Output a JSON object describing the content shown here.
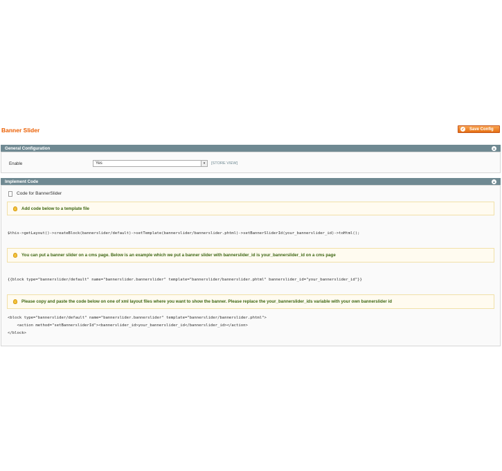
{
  "page": {
    "title": "Banner Slider",
    "save_label": "Save Config"
  },
  "general": {
    "header": "General Configuration",
    "enable_label": "Enable",
    "enable_value": "Yes",
    "scope": "[STORE VIEW]"
  },
  "implement": {
    "header": "Implement Code",
    "title": "Code for BannerSlider",
    "note1": "Add code below to a template file",
    "code1": "$this->getLayout()->createBlock(bannerslider/default)->setTemplate(bannerslider/bannerslider.phtml)->setBannerSliderId(your_bannerslider_id)->toHtml();",
    "note2": "You can put a banner slider on a cms page. Below is an example which we put a banner slider with bannerslider_id is your_bannerslider_id on a cms page",
    "code2": "{{block type=\"bannerslider/default\" name=\"bannerslider.bannerslider\" template=\"bannerslider/bannerslider.phtml\" bannerslider_id=\"your_bannerslider_id\"}}",
    "note3": "Please copy and paste the code below on one of xml layout files where you want to show the banner. Please replace the your_bannerslider_ids variable with your own bannerslider id",
    "code3_line1": "<block type=\"bannerslider/default\" name=\"bannerslider.bannerslider\" template=\"bannerslider/bannerslider.phtml\">",
    "code3_line2": "    <action method=\"setBannersliderId\"><bannerslider_id>your_bannerslider_id</bannerslider_id></action>",
    "code3_line3": "</block>"
  },
  "colors": {
    "accent": "#eb5e00",
    "section_header": "#6f8992",
    "note_bg": "#fffbf0",
    "note_text": "#3d6611"
  }
}
